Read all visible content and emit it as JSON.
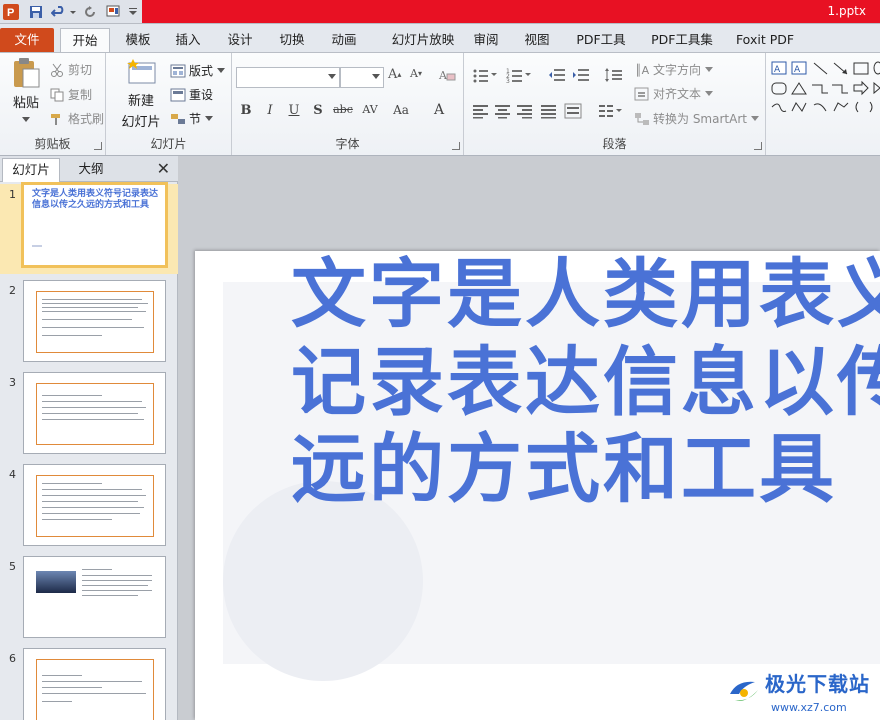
{
  "window": {
    "title": "1.pptx"
  },
  "tabs": [
    {
      "id": "file",
      "label": "文件"
    },
    {
      "id": "home",
      "label": "开始"
    },
    {
      "id": "template",
      "label": "模板"
    },
    {
      "id": "insert",
      "label": "插入"
    },
    {
      "id": "design",
      "label": "设计"
    },
    {
      "id": "transitions",
      "label": "切换"
    },
    {
      "id": "animations",
      "label": "动画"
    },
    {
      "id": "slideshow",
      "label": "幻灯片放映"
    },
    {
      "id": "review",
      "label": "审阅"
    },
    {
      "id": "view",
      "label": "视图"
    },
    {
      "id": "pdftools",
      "label": "PDF工具"
    },
    {
      "id": "pdftoolset",
      "label": "PDF工具集"
    },
    {
      "id": "foxit",
      "label": "Foxit PDF"
    }
  ],
  "ribbon": {
    "clipboard": {
      "label": "剪贴板",
      "paste": "粘贴",
      "cut": "剪切",
      "copy": "复制",
      "format_painter": "格式刷"
    },
    "slides": {
      "label": "幻灯片",
      "new_slide_line1": "新建",
      "new_slide_line2": "幻灯片",
      "layout": "版式",
      "reset": "重设",
      "section": "节"
    },
    "font": {
      "label": "字体"
    },
    "paragraph": {
      "label": "段落",
      "text_direction": "文字方向",
      "align_text": "对齐文本",
      "convert_smartart": "转换为 SmartArt"
    }
  },
  "panel": {
    "tab_slides": "幻灯片",
    "tab_outline": "大纲",
    "close": "✕",
    "thumbs": [
      {
        "num": "1",
        "title": "文字是人类用表义符号记录表达信息以传之久远的方式和工具"
      },
      {
        "num": "2"
      },
      {
        "num": "3"
      },
      {
        "num": "4"
      },
      {
        "num": "5"
      },
      {
        "num": "6"
      }
    ]
  },
  "slide": {
    "lines": [
      "文字是人类用表义",
      "记录表达信息以传",
      "远的方式和工具"
    ]
  },
  "watermark": {
    "name": "极光下载站",
    "url": "www.xz7.com"
  },
  "colors": {
    "accent_blue": "#4a72d6",
    "file_tab": "#d04a1c",
    "title_red": "#e81123",
    "selected_thumb": "#f1c15a"
  }
}
